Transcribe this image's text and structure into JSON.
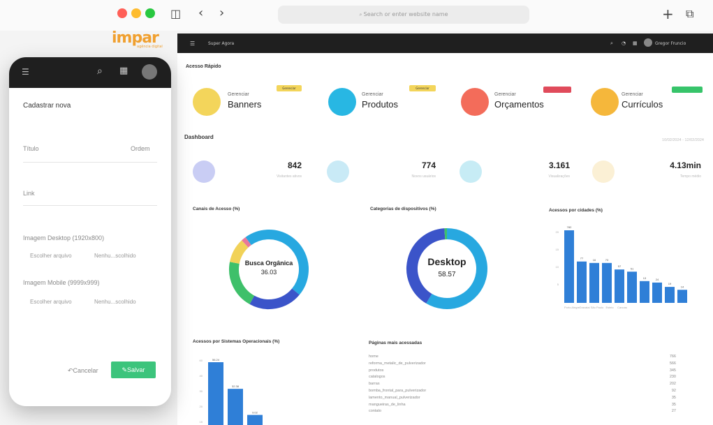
{
  "browser": {
    "url_placeholder": "Search or enter website name",
    "dot_colors": [
      "#ff5f57",
      "#febc2e",
      "#28c840"
    ]
  },
  "brand": {
    "name": "impar",
    "sub": "agência digital"
  },
  "topbar": {
    "menu_label": "Super Agora",
    "user": "Gregor Fruncio"
  },
  "quick_access": {
    "title": "Acesso Rápido",
    "items": [
      {
        "sub": "Gerenciar",
        "title": "Banners",
        "badge": "Gerenciar",
        "color": "#f3d55b",
        "badge_color": "#f3d55b"
      },
      {
        "sub": "Gerenciar",
        "title": "Produtos",
        "badge": "Gerenciar",
        "color": "#28b7e3",
        "badge_color": "#f3d55b"
      },
      {
        "sub": "Gerenciar",
        "title": "Orçamentos",
        "badge": "",
        "color": "#f36c5a",
        "badge_color": "#e04b5b"
      },
      {
        "sub": "Gerenciar",
        "title": "Currículos",
        "badge": "",
        "color": "#f5b73b",
        "badge_color": "#37c46a"
      }
    ]
  },
  "dashboard": {
    "title": "Dashboard",
    "date_range": "10/02/2024 - 12/02/2024",
    "stats": [
      {
        "value": "842",
        "label": "Visitantes ativos",
        "color": "#c9cdf4"
      },
      {
        "value": "774",
        "label": "Novos usuários",
        "color": "#c9eaf6"
      },
      {
        "value": "3.161",
        "label": "Visualizações",
        "color": "#c7ecf5"
      },
      {
        "value": "4.13min",
        "label": "Tempo médio",
        "color": "#fbf0d5"
      }
    ]
  },
  "chart_data": [
    {
      "type": "pie",
      "title": "Canais de Acesso (%)",
      "center_label": "Busca Orgânica",
      "center_value": "36.03",
      "slices": [
        {
          "value": 36.03,
          "color": "#27a8e0"
        },
        {
          "value": 22,
          "color": "#3b54c9"
        },
        {
          "value": 20,
          "color": "#3ec06a"
        },
        {
          "value": 10,
          "color": "#f1d258"
        },
        {
          "value": 2,
          "color": "#e8789a"
        },
        {
          "value": 9.97,
          "color": "#27a8e0"
        }
      ]
    },
    {
      "type": "pie",
      "title": "Categorias de dispositivos (%)",
      "center_label": "Desktop",
      "center_value": "58.57",
      "slices": [
        {
          "value": 58.57,
          "color": "#27a8e0"
        },
        {
          "value": 40.43,
          "color": "#3b54c9"
        },
        {
          "value": 1,
          "color": "#3ec06a"
        }
      ]
    },
    {
      "type": "bar",
      "title": "Acessos por cidades (%)",
      "categories": [
        "Porto Alegre",
        "Gravataí",
        "São Paulo",
        "Esteio",
        "Canoas",
        "",
        "",
        "",
        "",
        ""
      ],
      "values": [
        782,
        77,
        16,
        73,
        57,
        51,
        13,
        24,
        19,
        14
      ],
      "heights": [
        100,
        57,
        55,
        55,
        46,
        43,
        30,
        28,
        22,
        18
      ],
      "ytick_labels": [
        "20",
        "15",
        "10",
        "5"
      ],
      "color": "#2f7fd7"
    },
    {
      "type": "bar",
      "title": "Acessos por Sistemas Operacionais (%)",
      "values": [
        56.24,
        32.38,
        9.02
      ],
      "value_labels": [
        "56.24",
        "32.38",
        "9.02"
      ],
      "ytick_labels": [
        "60",
        "40",
        "30",
        "20",
        "15"
      ],
      "color": "#2f7fd7"
    }
  ],
  "top_pages": {
    "title": "Páginas mais acessadas",
    "rows": [
      {
        "name": "home",
        "value": "766"
      },
      {
        "name": "reforma_metalic_de_pulverizador",
        "value": "566"
      },
      {
        "name": "produtos",
        "value": "345"
      },
      {
        "name": "catalogos",
        "value": "230"
      },
      {
        "name": "barras",
        "value": "202"
      },
      {
        "name": "bomba_frontal_para_pulverizador",
        "value": "92"
      },
      {
        "name": "lamento_manual_pulverizador",
        "value": "35"
      },
      {
        "name": "mangueiras_de_linha",
        "value": "35"
      },
      {
        "name": "contato",
        "value": "27"
      }
    ]
  },
  "form": {
    "title": "Cadastrar nova",
    "fields": {
      "titulo": "Título",
      "ordem": "Ordem",
      "link": "Link",
      "img_desktop": "Imagem Desktop (1920x800)",
      "img_mobile": "Imagem Mobile (9999x999)",
      "choose_file": "Escolher arquivo",
      "no_file": "Nenhu...scolhido"
    },
    "cancel": "Cancelar",
    "save": "Salvar"
  }
}
